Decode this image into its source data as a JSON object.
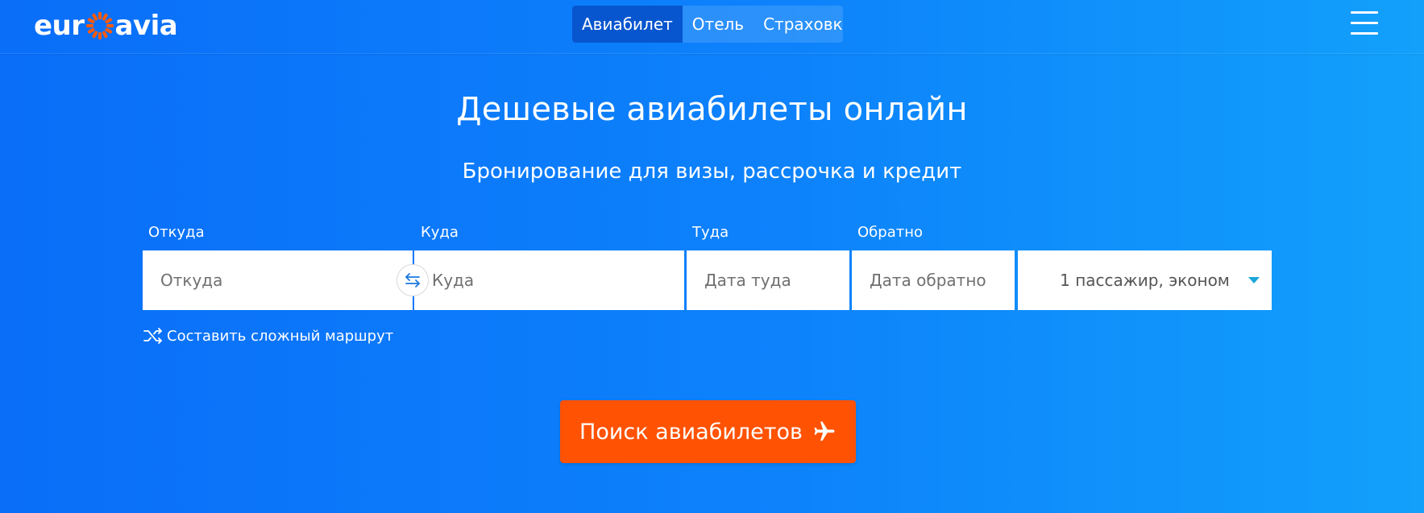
{
  "brand": {
    "logo_left": "eur",
    "logo_right": "avia",
    "logo_icon": "sun-ring-icon",
    "accent_orange": "#ff5203"
  },
  "header": {
    "tabs": [
      {
        "label": "Авиабилет",
        "active": true
      },
      {
        "label": "Отель",
        "active": false
      },
      {
        "label": "Страховка",
        "active": false
      }
    ],
    "menu_icon": "hamburger-menu-icon"
  },
  "hero": {
    "title": "Дешевые авиабилеты онлайн",
    "subtitle": "Бронирование для визы, рассрочка и кредит"
  },
  "search": {
    "from": {
      "label": "Откуда",
      "placeholder": "Откуда",
      "value": ""
    },
    "to": {
      "label": "Куда",
      "placeholder": "Куда",
      "value": ""
    },
    "depart": {
      "label": "Туда",
      "placeholder": "Дата туда",
      "value": ""
    },
    "return": {
      "label": "Обратно",
      "placeholder": "Дата обратно",
      "value": ""
    },
    "passengers": {
      "value": "1 пассажир, эконом",
      "caret_color": "#1aa7d8"
    },
    "swap_icon": "swap-arrows-icon",
    "complex_route": {
      "label": "Составить сложный маршрут",
      "icon": "shuffle-icon"
    },
    "submit": {
      "label": "Поиск авиабилетов",
      "icon": "airplane-icon"
    }
  }
}
